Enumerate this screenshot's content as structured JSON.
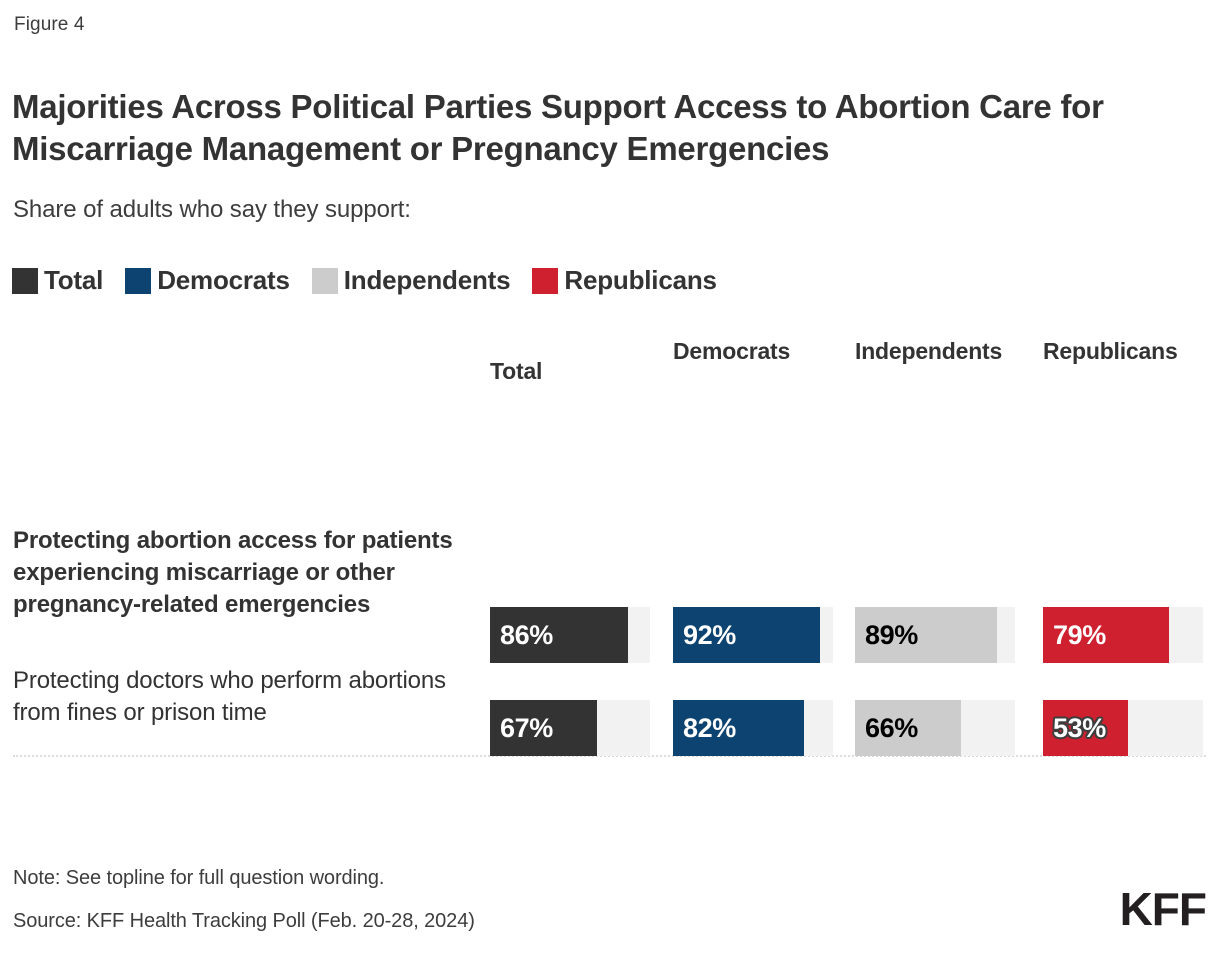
{
  "figure_label": "Figure 4",
  "title": "Majorities Across Political Parties Support Access to Abortion Care for Miscarriage Management or Pregnancy Emergencies",
  "subtitle": "Share of adults who say they support:",
  "legend": [
    {
      "label": "Total",
      "color": "#333333"
    },
    {
      "label": "Democrats",
      "color": "#0d4370"
    },
    {
      "label": "Independents",
      "color": "#cccccc"
    },
    {
      "label": "Republicans",
      "color": "#cf2030"
    }
  ],
  "columns": [
    {
      "header": "Total"
    },
    {
      "header": "Democrats"
    },
    {
      "header": "Independents"
    },
    {
      "header": "Republicans"
    }
  ],
  "rows": [
    {
      "label": "Protecting abortion access for patients experiencing miscarriage or other pregnancy-related emergencies",
      "values": [
        "86%",
        "92%",
        "89%",
        "79%"
      ]
    },
    {
      "label": "Protecting doctors who perform abortions from fines or prison time",
      "values": [
        "67%",
        "82%",
        "66%",
        "53%"
      ]
    }
  ],
  "footer": {
    "note": "Note: See topline for full question wording.",
    "source": "Source: KFF Health Tracking Poll (Feb. 20-28, 2024)"
  },
  "logo": "KFF",
  "chart_data": {
    "type": "bar",
    "title": "Majorities Across Political Parties Support Access to Abortion Care for Miscarriage Management or Pregnancy Emergencies",
    "subtitle": "Share of adults who say they support:",
    "orientation": "horizontal",
    "layout": "small-multiples-grid",
    "categories": [
      "Protecting abortion access for patients experiencing miscarriage or other pregnancy-related emergencies",
      "Protecting doctors who perform abortions from fines or prison time"
    ],
    "series": [
      {
        "name": "Total",
        "color": "#333333",
        "values": [
          86,
          92,
          89,
          79
        ]
      },
      {
        "name": "Democrats",
        "color": "#0d4370",
        "values": [
          67,
          82,
          66,
          53
        ]
      }
    ],
    "grid_values": [
      {
        "category": "Protecting abortion access for patients experiencing miscarriage or other pregnancy-related emergencies",
        "Total": 86,
        "Democrats": 92,
        "Independents": 89,
        "Republicans": 79
      },
      {
        "category": "Protecting doctors who perform abortions from fines or prison time",
        "Total": 67,
        "Democrats": 82,
        "Independents": 66,
        "Republicans": 53
      }
    ],
    "groups": [
      "Total",
      "Democrats",
      "Independents",
      "Republicans"
    ],
    "xlabel": "",
    "ylabel": "",
    "xlim": [
      0,
      100
    ],
    "unit": "percent",
    "grid": false,
    "legend_position": "top-left",
    "note": "Note: See topline for full question wording.",
    "source": "Source: KFF Health Tracking Poll (Feb. 20-28, 2024)"
  }
}
